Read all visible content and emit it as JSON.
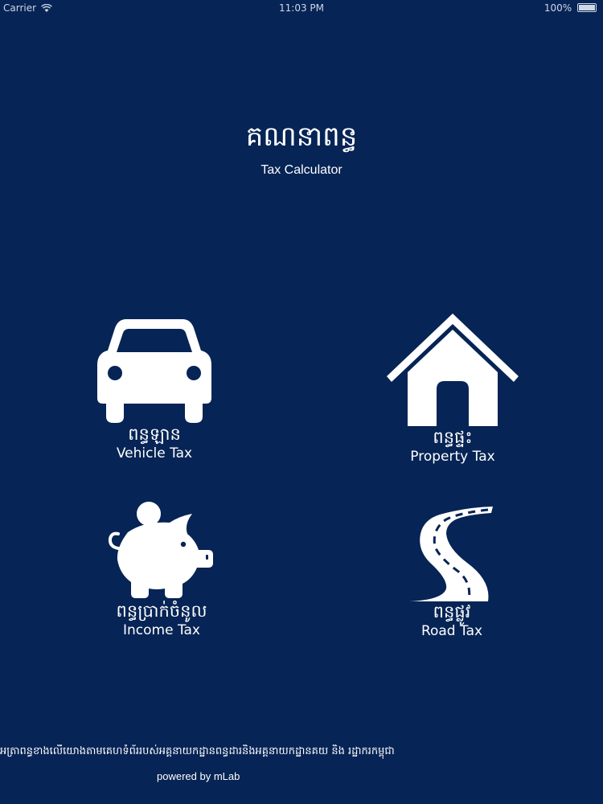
{
  "status_bar": {
    "carrier": "Carrier",
    "time": "11:03 PM",
    "battery": "100%",
    "battery_level": 1.0,
    "wifi_icon": "wifi-icon"
  },
  "header": {
    "title_kh": "គណនាពន្ធ",
    "title_en": "Tax Calculator"
  },
  "tiles": [
    {
      "id": "vehicle",
      "icon": "car-icon",
      "label_kh": "ពន្ធឡាន",
      "label_en": "Vehicle  Tax"
    },
    {
      "id": "property",
      "icon": "house-icon",
      "label_kh": "ពន្ធផ្ទះ",
      "label_en": "Property Tax"
    },
    {
      "id": "income",
      "icon": "piggy-bank-icon",
      "label_kh": "ពន្ធប្រាក់ចំនូល",
      "label_en": "Income  Tax"
    },
    {
      "id": "road",
      "icon": "road-icon",
      "label_kh": "ពន្ធផ្លូវ",
      "label_en": "Road Tax"
    }
  ],
  "footer": {
    "note_kh": "អត្រាពន្ធខាងលើយោងតាមគេហទំព័ររបស់អគ្គនាយកដ្ឋានពន្ធដារនិងអគ្គនាយកដ្ឋានគយ និង រដ្ឋាករកម្ពុជា",
    "powered_by": "powered by mLab"
  },
  "colors": {
    "background": "#062455",
    "foreground": "#ffffff"
  }
}
